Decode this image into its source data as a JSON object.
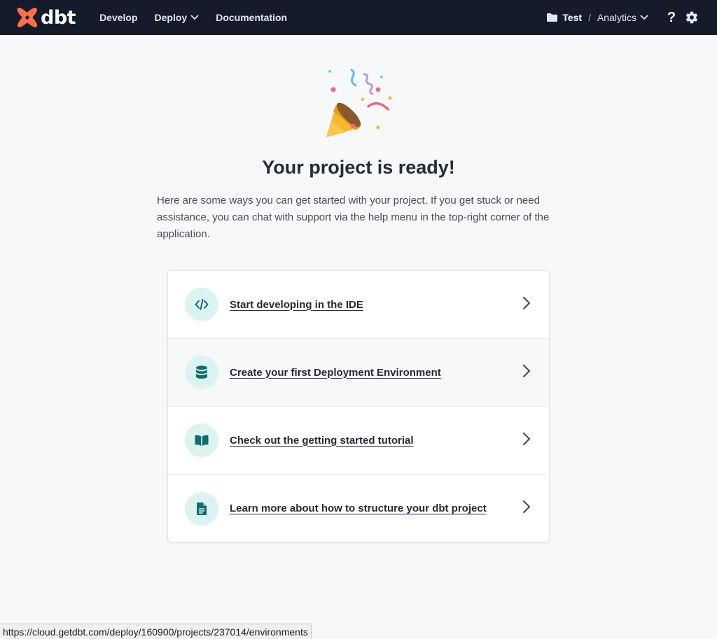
{
  "brand": {
    "name": "dbt",
    "color": "#fe6f4b"
  },
  "nav": {
    "items": [
      {
        "label": "Develop"
      },
      {
        "label": "Deploy"
      },
      {
        "label": "Documentation"
      }
    ]
  },
  "header": {
    "project": "Test",
    "separator": "/",
    "environment": "Analytics",
    "help_glyph": "?"
  },
  "main": {
    "title": "Your project is ready!",
    "intro": "Here are some ways you can get started with your project. If you get stuck or need assistance, you can chat with support via the help menu in the top-right corner of the application.",
    "actions": [
      {
        "label": "Start developing in the IDE",
        "icon": "code-icon"
      },
      {
        "label": "Create your first Deployment Environment",
        "icon": "database-icon"
      },
      {
        "label": "Check out the getting started tutorial",
        "icon": "book-icon"
      },
      {
        "label": "Learn more about how to structure your dbt project",
        "icon": "document-icon"
      }
    ]
  },
  "status_bar": {
    "url": "https://cloud.getdbt.com/deploy/160900/projects/237014/environments"
  },
  "colors": {
    "topbar_bg": "#161b2b",
    "accent_teal": "#0d6e6e",
    "icon_circle_bg": "#dcf3f1",
    "page_bg": "#f7f8fa"
  }
}
